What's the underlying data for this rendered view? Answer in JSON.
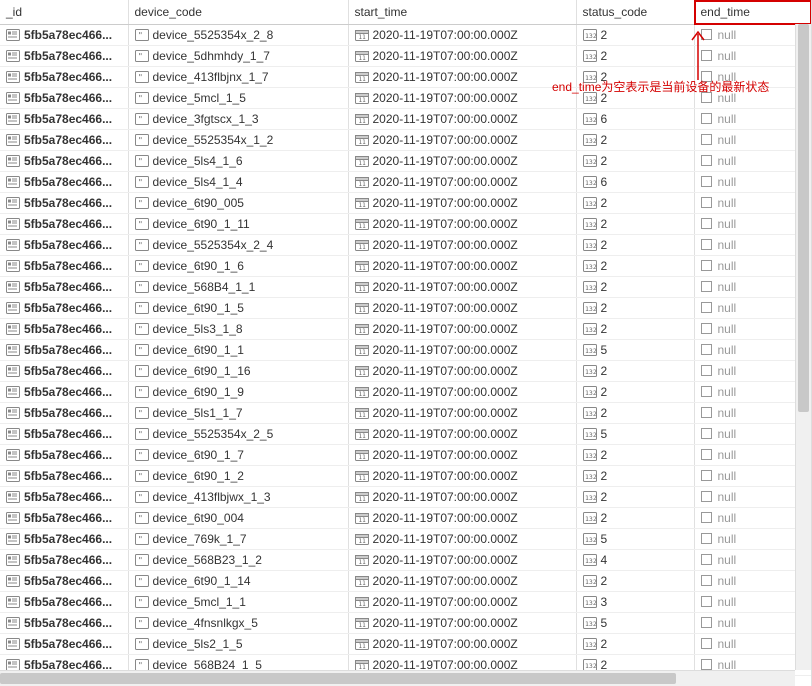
{
  "columns": {
    "id": "_id",
    "device_code": "device_code",
    "start_time": "start_time",
    "status_code": "status_code",
    "end_time": "end_time"
  },
  "id_display": "5fb5a78ec466...",
  "start_time_value": "2020-11-19T07:00:00.000Z",
  "null_label": "null",
  "annotation_text": "end_time为空表示是当前设备的最新状态",
  "rows": [
    {
      "device": "device_5525354x_2_8",
      "status": "2"
    },
    {
      "device": "device_5dhmhdy_1_7",
      "status": "2"
    },
    {
      "device": "device_413flbjnx_1_7",
      "status": "2"
    },
    {
      "device": "device_5mcl_1_5",
      "status": "2"
    },
    {
      "device": "device_3fgtscx_1_3",
      "status": "6"
    },
    {
      "device": "device_5525354x_1_2",
      "status": "2"
    },
    {
      "device": "device_5ls4_1_6",
      "status": "2"
    },
    {
      "device": "device_5ls4_1_4",
      "status": "6"
    },
    {
      "device": "device_6t90_005",
      "status": "2"
    },
    {
      "device": "device_6t90_1_11",
      "status": "2"
    },
    {
      "device": "device_5525354x_2_4",
      "status": "2"
    },
    {
      "device": "device_6t90_1_6",
      "status": "2"
    },
    {
      "device": "device_568B4_1_1",
      "status": "2"
    },
    {
      "device": "device_6t90_1_5",
      "status": "2"
    },
    {
      "device": "device_5ls3_1_8",
      "status": "2"
    },
    {
      "device": "device_6t90_1_1",
      "status": "5"
    },
    {
      "device": "device_6t90_1_16",
      "status": "2"
    },
    {
      "device": "device_6t90_1_9",
      "status": "2"
    },
    {
      "device": "device_5ls1_1_7",
      "status": "2"
    },
    {
      "device": "device_5525354x_2_5",
      "status": "5"
    },
    {
      "device": "device_6t90_1_7",
      "status": "2"
    },
    {
      "device": "device_6t90_1_2",
      "status": "2"
    },
    {
      "device": "device_413flbjwx_1_3",
      "status": "2"
    },
    {
      "device": "device_6t90_004",
      "status": "2"
    },
    {
      "device": "device_769k_1_7",
      "status": "5"
    },
    {
      "device": "device_568B23_1_2",
      "status": "4"
    },
    {
      "device": "device_6t90_1_14",
      "status": "2"
    },
    {
      "device": "device_5mcl_1_1",
      "status": "3"
    },
    {
      "device": "device_4fnsnlkgx_5",
      "status": "5"
    },
    {
      "device": "device_5ls2_1_5",
      "status": "2"
    },
    {
      "device": "device_568B24_1_5",
      "status": "2"
    }
  ]
}
